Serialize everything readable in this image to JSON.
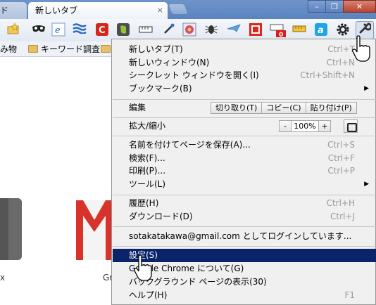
{
  "tabs": [
    {
      "title": "ド",
      "active": false
    },
    {
      "title": "新しいタブ",
      "active": true
    }
  ],
  "tab_close_glyph": "×",
  "window_controls": {
    "minimize": "–",
    "maximize": "❐",
    "close": "✕"
  },
  "toolbar_icons": [
    "star-folder-icon",
    "mask-icon",
    "ie-icon",
    "waves-icon",
    "c-red-icon",
    "evernote-icon",
    "ruler-icon",
    "eyedropper-icon",
    "gear-flower-icon",
    "bug-icon",
    "plane-icon",
    "stop-square-icon",
    "counter-badge-icon",
    "ruler-yellow-icon",
    "a-blue-icon",
    "gear-icon",
    "wrench-icon"
  ],
  "toolbar_badge": "0",
  "bookmarks": [
    {
      "label": "読み物"
    },
    {
      "label": "キーワード調査"
    }
  ],
  "page": {
    "tile_left_label": "x",
    "tile_gmail_label": "Gr"
  },
  "menu": {
    "new_tab": {
      "label": "新しいタブ(T)",
      "shortcut": "Ctrl+T"
    },
    "new_window": {
      "label": "新しいウィンドウ(N)",
      "shortcut": "Ctrl+N"
    },
    "incognito": {
      "label": "シークレット ウィンドウを開く(I)",
      "shortcut": "Ctrl+Shift+N"
    },
    "bookmarks": {
      "label": "ブックマーク(B)"
    },
    "edit": {
      "label": "編集",
      "cut": "切り取り(T)",
      "copy": "コピー(C)",
      "paste": "貼り付け(P)"
    },
    "zoom": {
      "label": "拡大/縮小",
      "minus": "-",
      "value": "100%",
      "plus": "+"
    },
    "save_page": {
      "label": "名前を付けてページを保存(A)...",
      "shortcut": "Ctrl+S"
    },
    "find": {
      "label": "検索(F)...",
      "shortcut": "Ctrl+F"
    },
    "print": {
      "label": "印刷(P)...",
      "shortcut": "Ctrl+P"
    },
    "tools": {
      "label": "ツール(L)"
    },
    "history": {
      "label": "履歴(H)",
      "shortcut": "Ctrl+H"
    },
    "downloads": {
      "label": "ダウンロード(D)",
      "shortcut": "Ctrl+J"
    },
    "signin": {
      "label": "sotakatakawa@gmail.com としてログインしています..."
    },
    "settings": {
      "label": "設定(S)"
    },
    "about": {
      "label": "Google Chrome について(G)"
    },
    "background": {
      "label": "バックグラウンド ページの表示(30)"
    },
    "help": {
      "label": "ヘルプ(H)",
      "shortcut": "F1"
    }
  },
  "colors": {
    "highlight": "#0a246a",
    "tabstrip": "#5a84c0",
    "menu_bg": "#f0f0f0"
  }
}
